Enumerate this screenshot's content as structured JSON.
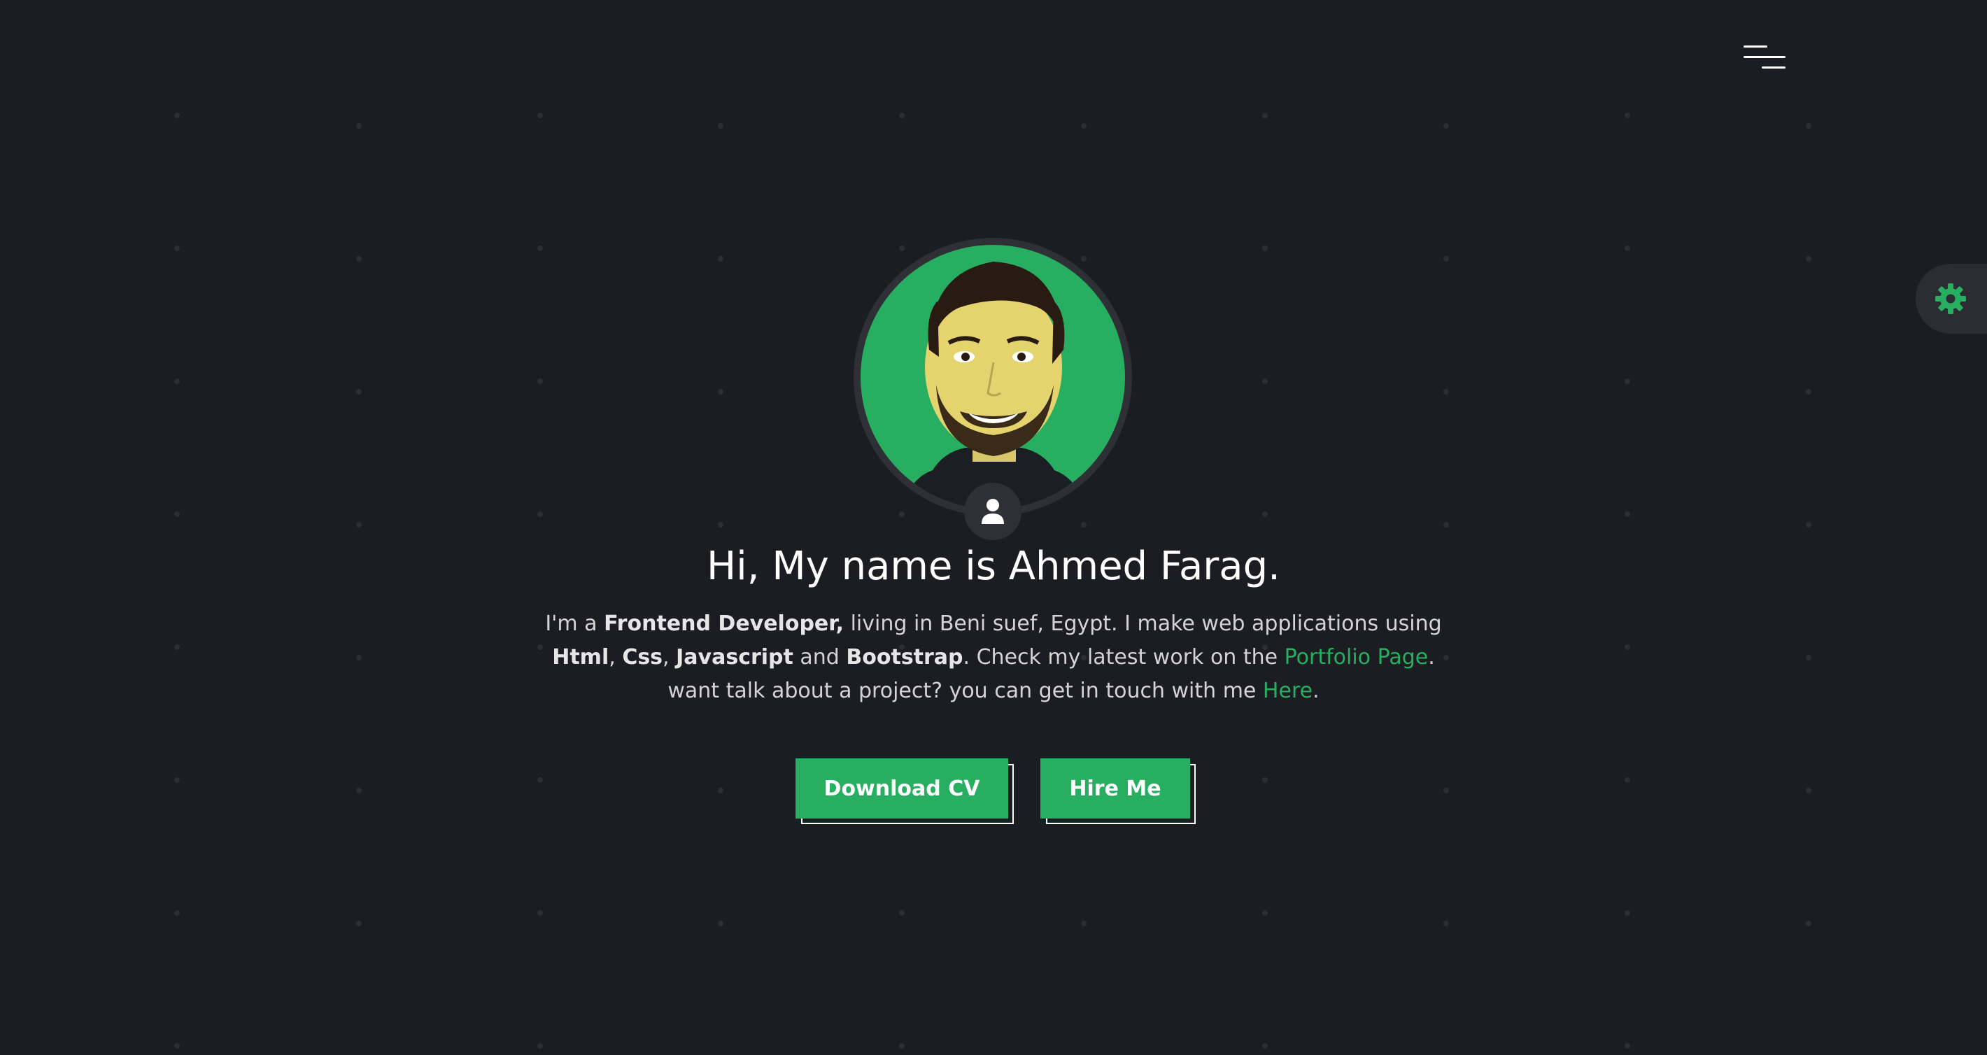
{
  "colors": {
    "background": "#1c1d22",
    "accent": "#27ae60",
    "surface": "#2e3036",
    "text": "#ffffff",
    "muted_text": "#d4d4d4"
  },
  "nav": {
    "menu_icon": "hamburger-menu-icon"
  },
  "settings": {
    "icon": "gear-icon"
  },
  "profile": {
    "photo_alt": "Ahmed Farag",
    "badge_icon": "user-icon"
  },
  "hero": {
    "title": "Hi, My name is Ahmed Farag.",
    "bio": {
      "part1": "I'm a ",
      "role": "Frontend Developer,",
      "part2": " living in Beni suef, Egypt. I make web applications using ",
      "skill1": "Html",
      "sep1": ", ",
      "skill2": "Css",
      "sep2": ", ",
      "skill3": "Javascript",
      "part3": " and ",
      "skill4": "Bootstrap",
      "part4": ". Check my latest work on the ",
      "portfolio_link": "Portfolio Page",
      "part5": ". want talk about a project? you can get in touch with me ",
      "contact_link": "Here",
      "part6": "."
    }
  },
  "actions": {
    "download_cv": "Download CV",
    "hire_me": "Hire Me"
  }
}
